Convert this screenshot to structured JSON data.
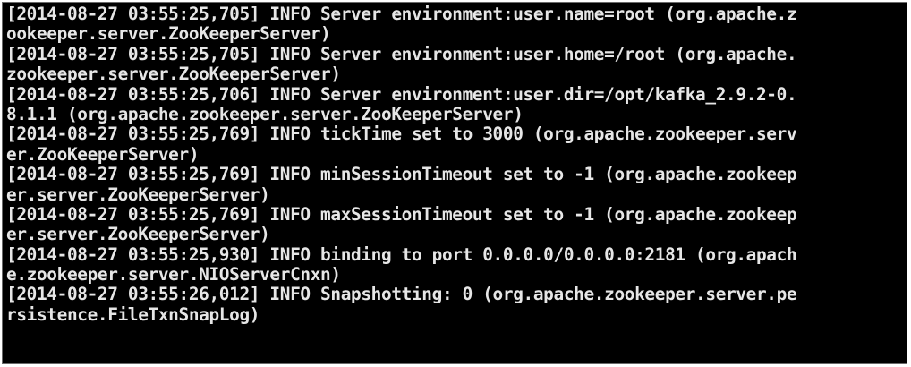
{
  "terminal": {
    "lines": [
      "[2014-08-27 03:55:25,705] INFO Server environment:user.name=root (org.apache.z",
      "ookeeper.server.ZooKeeperServer)",
      "[2014-08-27 03:55:25,705] INFO Server environment:user.home=/root (org.apache.",
      "zookeeper.server.ZooKeeperServer)",
      "[2014-08-27 03:55:25,706] INFO Server environment:user.dir=/opt/kafka_2.9.2-0.",
      "8.1.1 (org.apache.zookeeper.server.ZooKeeperServer)",
      "[2014-08-27 03:55:25,769] INFO tickTime set to 3000 (org.apache.zookeeper.serv",
      "er.ZooKeeperServer)",
      "[2014-08-27 03:55:25,769] INFO minSessionTimeout set to -1 (org.apache.zookeep",
      "er.server.ZooKeeperServer)",
      "[2014-08-27 03:55:25,769] INFO maxSessionTimeout set to -1 (org.apache.zookeep",
      "er.server.ZooKeeperServer)",
      "[2014-08-27 03:55:25,930] INFO binding to port 0.0.0.0/0.0.0.0:2181 (org.apach",
      "e.zookeeper.server.NIOServerCnxn)",
      "[2014-08-27 03:55:26,012] INFO Snapshotting: 0 (org.apache.zookeeper.server.pe",
      "rsistence.FileTxnSnapLog)"
    ]
  },
  "colors": {
    "background": "#000000",
    "text": "#e6e6e6"
  }
}
